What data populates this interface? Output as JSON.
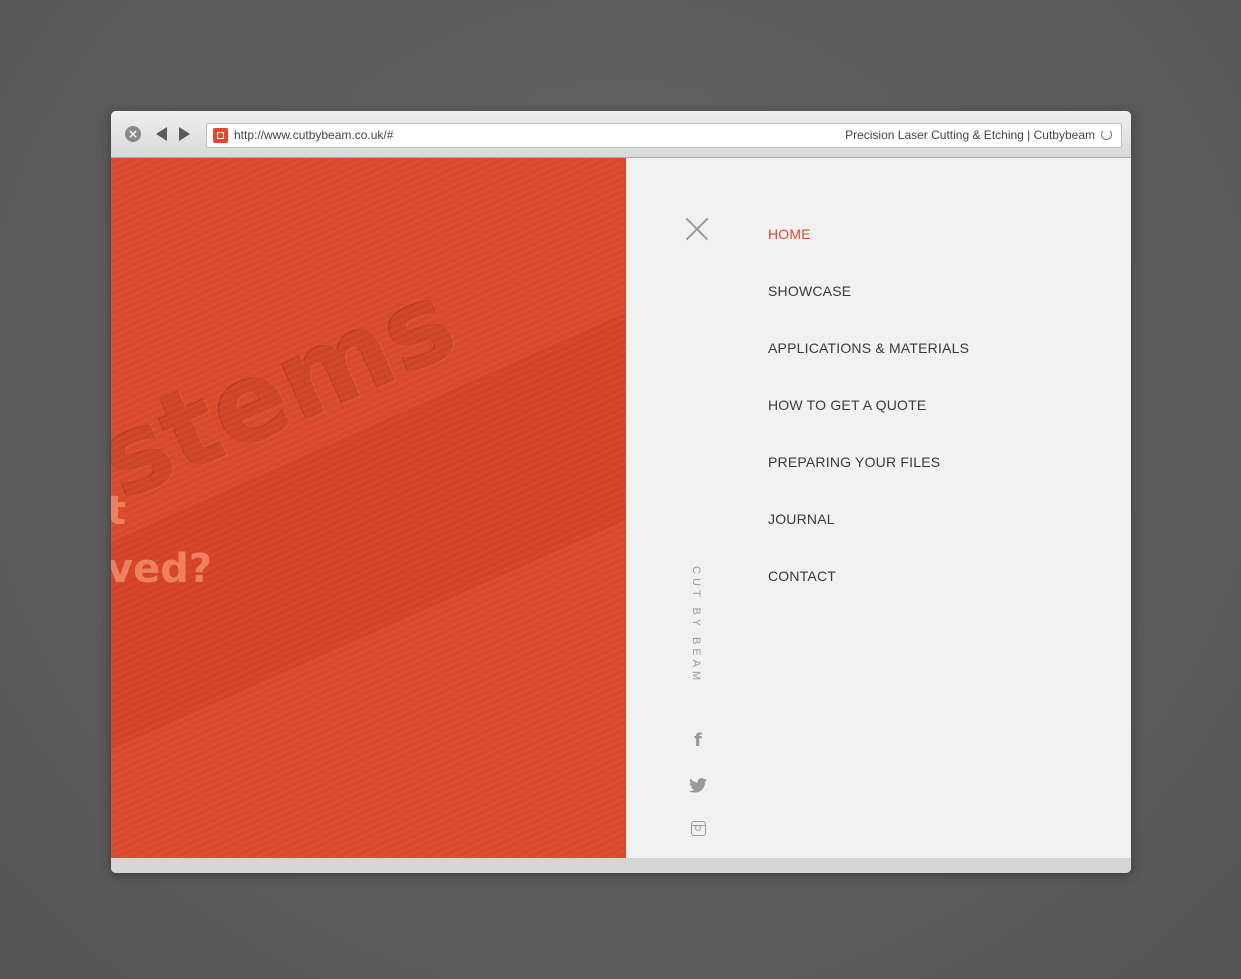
{
  "browser": {
    "url": "http://www.cutbybeam.co.uk/#",
    "page_title": "Precision Laser Cutting & Etching | Cutbybeam",
    "close_glyph": "×"
  },
  "hero": {
    "engraved_word": "stems",
    "headline_line_1": "t",
    "headline_line_2": "ved?",
    "background_color": "#db4b2d"
  },
  "menu": {
    "items": [
      {
        "label": "HOME",
        "active": true
      },
      {
        "label": "SHOWCASE",
        "active": false
      },
      {
        "label": "APPLICATIONS & MATERIALS",
        "active": false
      },
      {
        "label": "HOW TO GET A QUOTE",
        "active": false
      },
      {
        "label": "PREPARING YOUR FILES",
        "active": false
      },
      {
        "label": "JOURNAL",
        "active": false
      },
      {
        "label": "CONTACT",
        "active": false
      }
    ],
    "brand": "CUT BY BEAM",
    "accent_color": "#e34a2c",
    "social": {
      "facebook_glyph": "f",
      "icons": [
        "facebook-icon",
        "twitter-icon",
        "instagram-icon"
      ]
    }
  }
}
